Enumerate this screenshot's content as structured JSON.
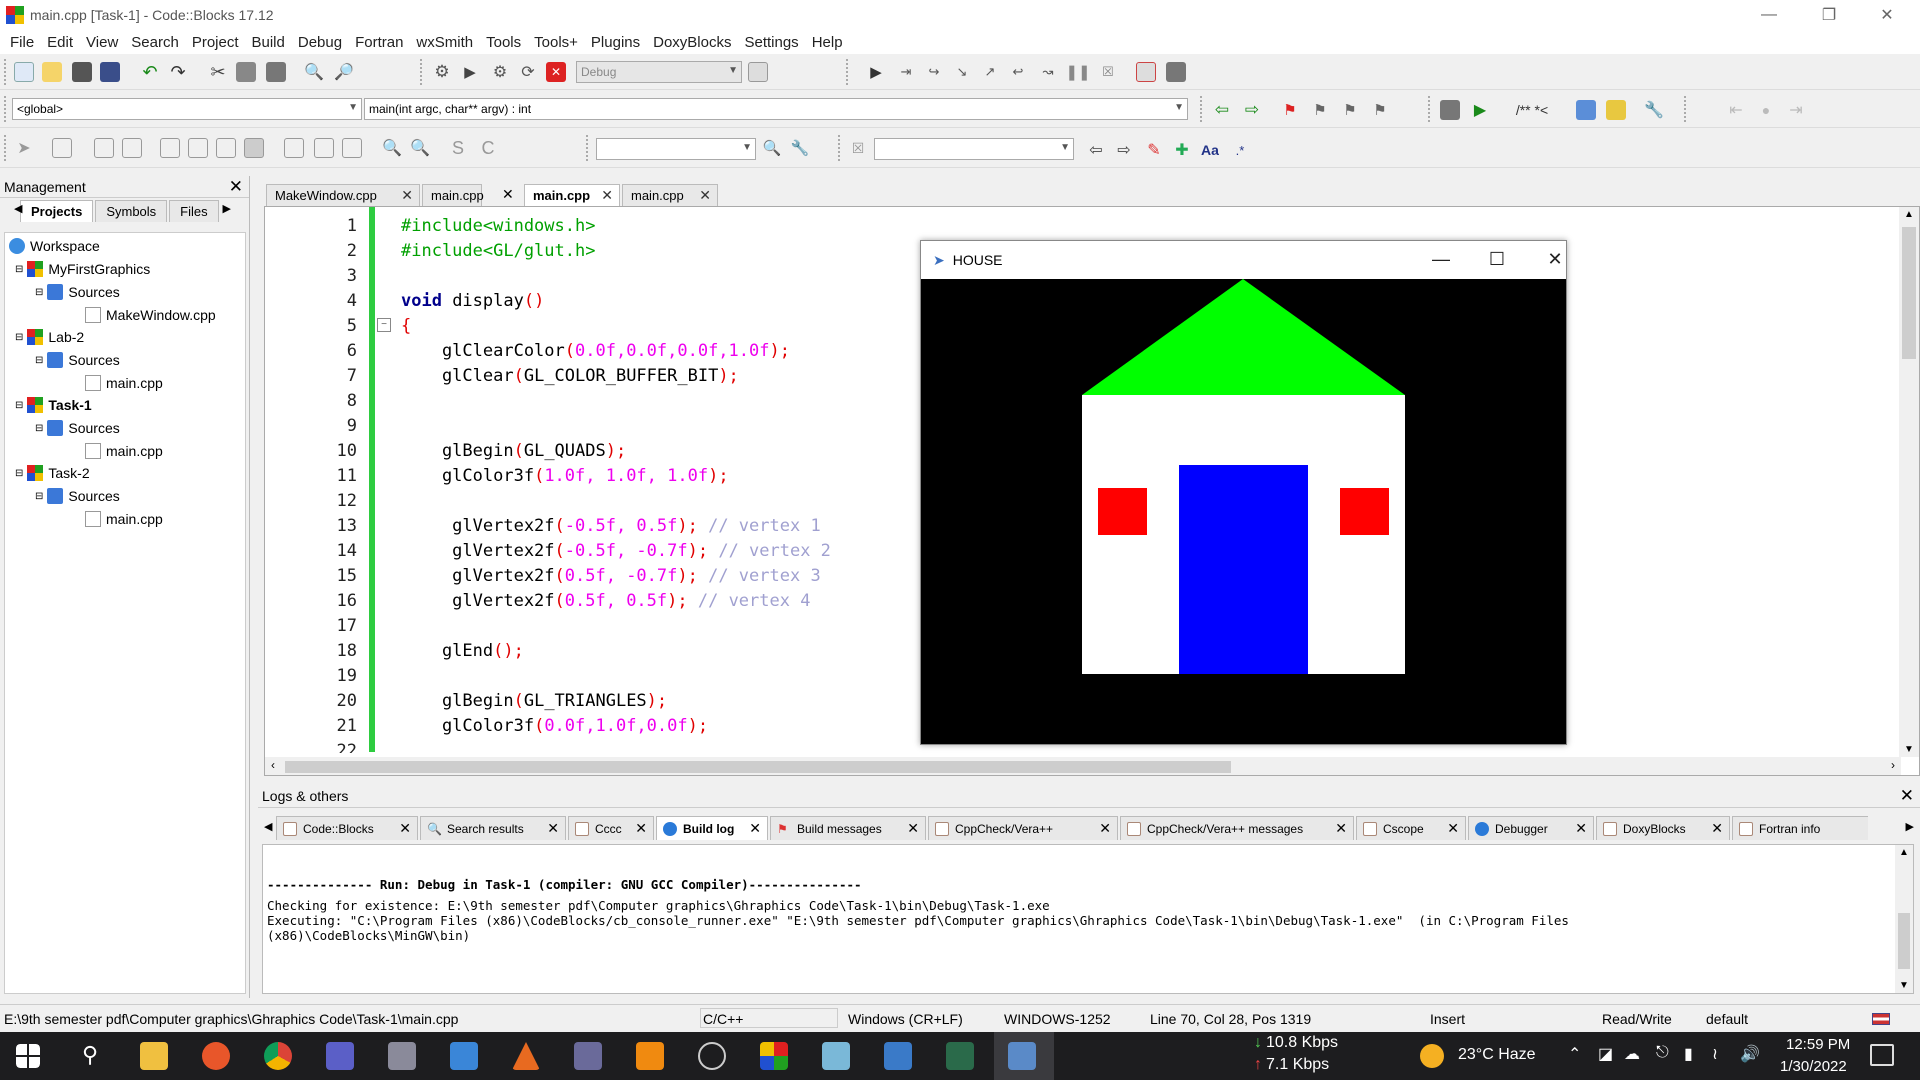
{
  "window": {
    "title": "main.cpp [Task-1] - Code::Blocks 17.12"
  },
  "menu": [
    "File",
    "Edit",
    "View",
    "Search",
    "Project",
    "Build",
    "Debug",
    "Fortran",
    "wxSmith",
    "Tools",
    "Tools+",
    "Plugins",
    "DoxyBlocks",
    "Settings",
    "Help"
  ],
  "toolbar": {
    "build_target": "Debug",
    "scope": "<global>",
    "function": "main(int argc, char** argv) : int",
    "search_text": "",
    "replace_text": "",
    "comment_buttons": "/** *<"
  },
  "management": {
    "title": "Management",
    "tabs": [
      "Projects",
      "Symbols",
      "Files"
    ],
    "tree": {
      "workspace": "Workspace",
      "projects": [
        {
          "name": "MyFirstGraphics",
          "folder": "Sources",
          "file": "MakeWindow.cpp",
          "active": false
        },
        {
          "name": "Lab-2",
          "folder": "Sources",
          "file": "main.cpp",
          "active": false
        },
        {
          "name": "Task-1",
          "folder": "Sources",
          "file": "main.cpp",
          "active": true
        },
        {
          "name": "Task-2",
          "folder": "Sources",
          "file": "main.cpp",
          "active": false
        }
      ]
    }
  },
  "editor": {
    "tabs": [
      {
        "label": "MakeWindow.cpp",
        "active": false
      },
      {
        "label": "main.cpp",
        "active": false
      },
      {
        "label": "main.cpp",
        "active": true
      },
      {
        "label": "main.cpp",
        "active": false
      }
    ],
    "line_numbers": [
      "1",
      "2",
      "3",
      "4",
      "5",
      "6",
      "7",
      "8",
      "9",
      "10",
      "11",
      "12",
      "13",
      "14",
      "15",
      "16",
      "17",
      "18",
      "19",
      "20",
      "21",
      "22"
    ],
    "code": {
      "l1": "#include<windows.h>",
      "l2": "#include<GL/glut.h>",
      "l4_kw": "void",
      "l4_fn": " display",
      "l4_op": "()",
      "l5": "{",
      "l6_fn": "    glClearColor",
      "l6_a": "(",
      "l6_n": "0.0f,0.0f,0.0f,1.0f",
      "l6_b": ");",
      "l7_fn": "    glClear",
      "l7_a": "(",
      "l7_arg": "GL_COLOR_BUFFER_BIT",
      "l7_b": ");",
      "l10_fn": "    glBegin",
      "l10_a": "(",
      "l10_arg": "GL_QUADS",
      "l10_b": ");",
      "l11_fn": "    glColor3f",
      "l11_a": "(",
      "l11_n": "1.0f, 1.0f, 1.0f",
      "l11_b": ");",
      "l13_fn": "     glVertex2f",
      "l13_a": "(",
      "l13_n": "-0.5f, 0.5f",
      "l13_b": ");",
      "l13_c": " // vertex 1",
      "l14_fn": "     glVertex2f",
      "l14_a": "(",
      "l14_n": "-0.5f, -0.7f",
      "l14_b": ");",
      "l14_c": " // vertex 2",
      "l15_fn": "     glVertex2f",
      "l15_a": "(",
      "l15_n": "0.5f, -0.7f",
      "l15_b": ");",
      "l15_c": " // vertex 3",
      "l16_fn": "     glVertex2f",
      "l16_a": "(",
      "l16_n": "0.5f, 0.5f",
      "l16_b": ");",
      "l16_c": " // vertex 4",
      "l18_fn": "    glEnd",
      "l18_b": "();",
      "l20_fn": "    glBegin",
      "l20_a": "(",
      "l20_arg": "GL_TRIANGLES",
      "l20_b": ");",
      "l21_fn": "    glColor3f",
      "l21_a": "(",
      "l21_n": "0.0f,1.0f,0.0f",
      "l21_b": ");"
    }
  },
  "house_window": {
    "title": "HOUSE",
    "colors": {
      "background": "#000000",
      "roof": "#00ff00",
      "wall": "#ffffff",
      "door": "#0000ff",
      "window": "#ff0000"
    }
  },
  "logs": {
    "title": "Logs & others",
    "tabs": [
      "Code::Blocks",
      "Search results",
      "Cccc",
      "Build log",
      "Build messages",
      "CppCheck/Vera++",
      "CppCheck/Vera++ messages",
      "Cscope",
      "Debugger",
      "DoxyBlocks",
      "Fortran info"
    ],
    "active_tab": "Build log",
    "lines": [
      "-------------- Run: Debug in Task-1 (compiler: GNU GCC Compiler)---------------",
      "Checking for existence: E:\\9th semester pdf\\Computer graphics\\Ghraphics Code\\Task-1\\bin\\Debug\\Task-1.exe",
      "Executing: \"C:\\Program Files (x86)\\CodeBlocks/cb_console_runner.exe\" \"E:\\9th semester pdf\\Computer graphics\\Ghraphics Code\\Task-1\\bin\\Debug\\Task-1.exe\"  (in C:\\Program Files",
      "(x86)\\CodeBlocks\\MinGW\\bin)"
    ]
  },
  "statusbar": {
    "path": "E:\\9th semester pdf\\Computer graphics\\Ghraphics Code\\Task-1\\main.cpp",
    "language": "C/C++",
    "line_endings": "Windows (CR+LF)",
    "encoding": "WINDOWS-1252",
    "position": "Line 70, Col 28, Pos 1319",
    "mode": "Insert",
    "access": "Read/Write",
    "profile": "default"
  },
  "taskbar": {
    "net_down": "10.8 Kbps",
    "net_up": "7.1 Kbps",
    "weather": "23°C  Haze",
    "time": "12:59 PM",
    "date": "1/30/2022"
  }
}
